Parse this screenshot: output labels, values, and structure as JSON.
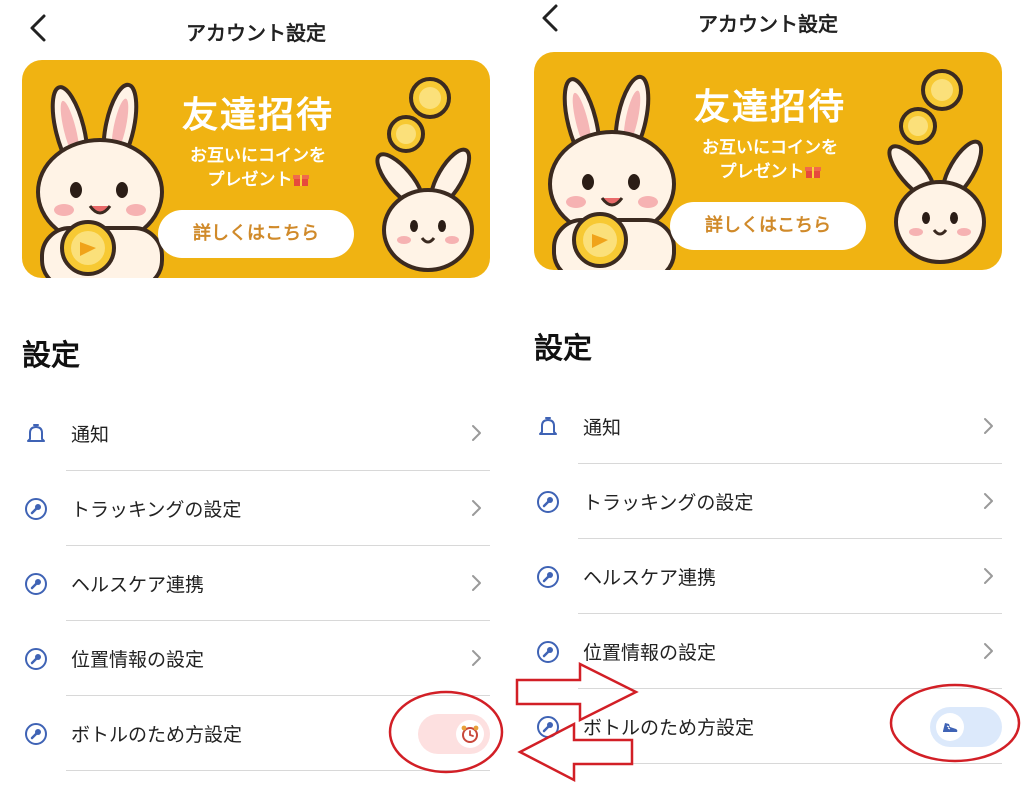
{
  "screens": [
    {
      "nav": {
        "title": "アカウント設定"
      },
      "banner": {
        "title": "友達招待",
        "subtitle_line1": "お互いにコインを",
        "subtitle_line2": "プレゼント",
        "button_label": "詳しくはこちら"
      },
      "section_title": "設定",
      "items": [
        {
          "label": "通知",
          "icon": "bell-icon"
        },
        {
          "label": "トラッキングの設定",
          "icon": "wrench-icon"
        },
        {
          "label": "ヘルスケア連携",
          "icon": "wrench-icon"
        },
        {
          "label": "位置情報の設定",
          "icon": "wrench-icon"
        },
        {
          "label": "ボトルのため方設定",
          "icon": "wrench-icon",
          "toggle_icon": "alarm-clock-icon"
        }
      ]
    },
    {
      "nav": {
        "title": "アカウント設定"
      },
      "banner": {
        "title": "友達招待",
        "subtitle_line1": "お互いにコインを",
        "subtitle_line2": "プレゼント",
        "button_label": "詳しくはこちら"
      },
      "section_title": "設定",
      "items": [
        {
          "label": "通知",
          "icon": "bell-icon"
        },
        {
          "label": "トラッキングの設定",
          "icon": "wrench-icon"
        },
        {
          "label": "ヘルスケア連携",
          "icon": "wrench-icon"
        },
        {
          "label": "位置情報の設定",
          "icon": "wrench-icon"
        },
        {
          "label": "ボトルのため方設定",
          "icon": "wrench-icon",
          "toggle_icon": "shoe-icon"
        }
      ]
    }
  ],
  "colors": {
    "banner_bg": "#f0b312",
    "icon_blue": "#3f63b5",
    "toggle_left_bg": "#fde0e0",
    "toggle_right_bg": "#dce9fb",
    "annotation_red": "#d21f26",
    "button_text": "#d08a2a"
  }
}
